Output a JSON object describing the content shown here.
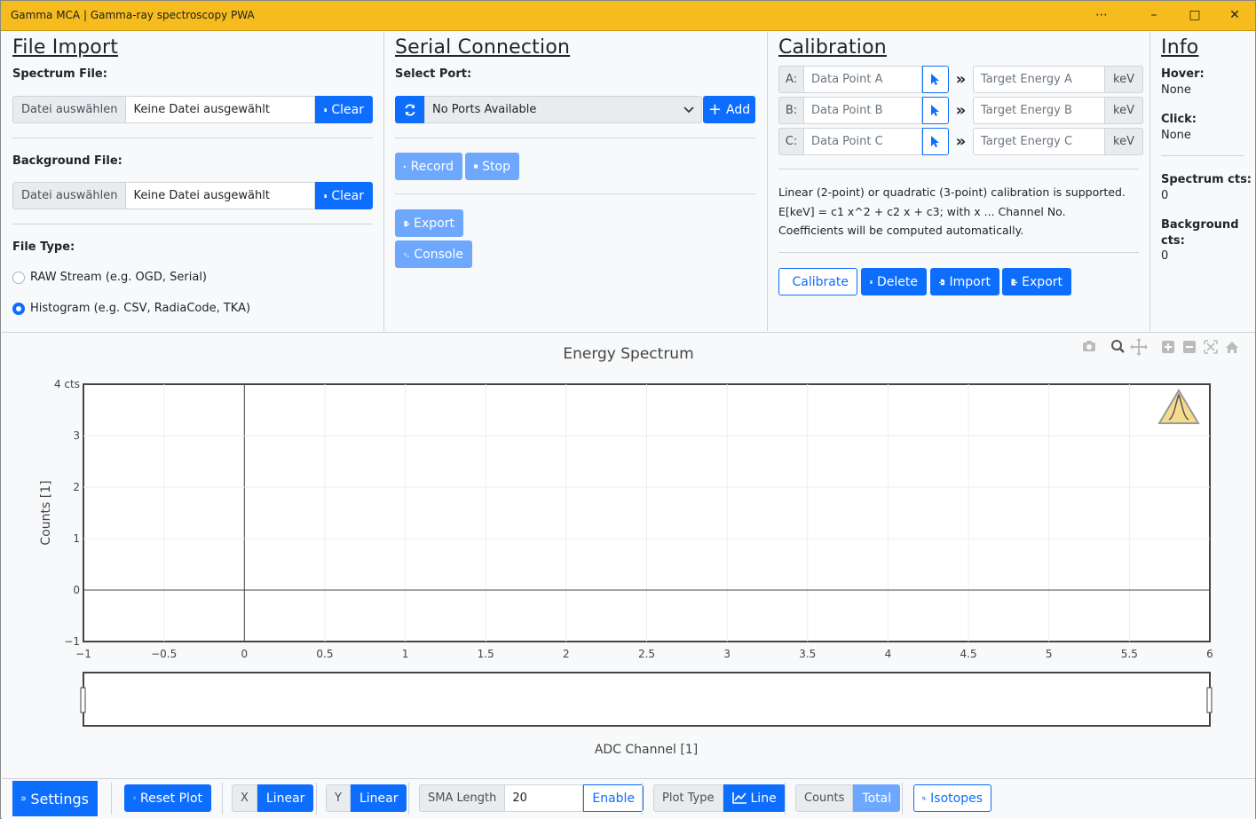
{
  "window": {
    "title": "Gamma MCA | Gamma-ray spectroscopy PWA",
    "more": "⋯",
    "minimize": "–",
    "maximize": "□",
    "close": "✕"
  },
  "file_import": {
    "title": "File Import",
    "spectrum_label": "Spectrum File:",
    "background_label": "Background File:",
    "choose_btn": "Datei auswählen",
    "no_file": "Keine Datei ausgewählt",
    "clear": "Clear",
    "type_label": "File Type:",
    "raw_option": "RAW Stream (e.g. OGD, Serial)",
    "hist_option": "Histogram (e.g. CSV, RadiaCode, TKA)"
  },
  "serial": {
    "title": "Serial Connection",
    "port_label": "Select Port:",
    "port_value": "No Ports Available",
    "add": "Add",
    "record": "Record",
    "stop": "Stop",
    "export": "Export",
    "console": "Console"
  },
  "calibration": {
    "title": "Calibration",
    "rows": [
      {
        "key": "A:",
        "point": "Data Point A",
        "energy": "Target Energy A",
        "unit": "keV"
      },
      {
        "key": "B:",
        "point": "Data Point B",
        "energy": "Target Energy B",
        "unit": "keV"
      },
      {
        "key": "C:",
        "point": "Data Point C",
        "energy": "Target Energy C",
        "unit": "keV"
      }
    ],
    "arrow": "»",
    "desc1": "Linear (2-point) or quadratic (3-point) calibration is supported.",
    "desc2": "E[keV] = c1 x^2 + c2 x + c3; with x ... Channel No.",
    "desc3": "Coefficients will be computed automatically.",
    "calibrate": "Calibrate",
    "delete": "Delete",
    "import": "Import",
    "export": "Export"
  },
  "info": {
    "title": "Info",
    "hover_label": "Hover:",
    "hover_value": "None",
    "click_label": "Click:",
    "click_value": "None",
    "spectrum_label": "Spectrum cts:",
    "spectrum_value": "0",
    "background_label_1": "Background",
    "background_label_2": "cts:",
    "background_value": "0"
  },
  "chart_data": {
    "type": "line",
    "title": "Energy Spectrum",
    "xlabel": "ADC Channel [1]",
    "ylabel": "Counts [1]",
    "xlim": [
      -1,
      6
    ],
    "ylim": [
      -1,
      4
    ],
    "xticks": [
      "−1",
      "−0.5",
      "0",
      "0.5",
      "1",
      "1.5",
      "2",
      "2.5",
      "3",
      "3.5",
      "4",
      "4.5",
      "5",
      "5.5",
      "6"
    ],
    "yticks": [
      "−1",
      "0",
      "1",
      "2",
      "3",
      "4 cts"
    ],
    "series": [],
    "grid": true
  },
  "bottombar": {
    "settings": "Settings",
    "reset": "Reset Plot",
    "x_label": "X",
    "x_value": "Linear",
    "y_label": "Y",
    "y_value": "Linear",
    "sma_label": "SMA Length",
    "sma_value": "20",
    "enable": "Enable",
    "plot_type_label": "Plot Type",
    "plot_type_value": "Line",
    "counts": "Counts",
    "total": "Total",
    "isotopes": "Isotopes"
  },
  "colors": {
    "titlebar": "#f6bc1e",
    "primary": "#0d6efd",
    "disabled": "#6ea8fe"
  }
}
